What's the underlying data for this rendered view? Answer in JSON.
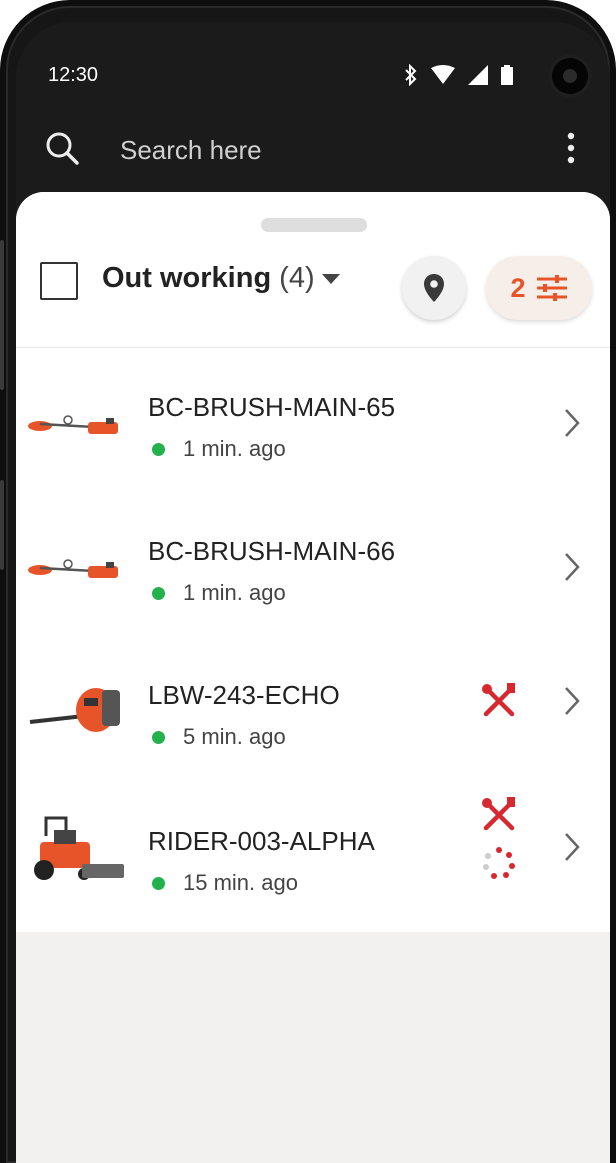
{
  "status_bar": {
    "time": "12:30"
  },
  "search": {
    "placeholder": "Search here"
  },
  "list": {
    "title": "Out working",
    "count": "(4)"
  },
  "filter": {
    "count": "2"
  },
  "items": [
    {
      "name": "BC-BRUSH-MAIN-65",
      "time": "1 min. ago",
      "status_color": "#22b14c",
      "service": false,
      "connectivity": false
    },
    {
      "name": "BC-BRUSH-MAIN-66",
      "time": "1 min. ago",
      "status_color": "#22b14c",
      "service": false,
      "connectivity": false
    },
    {
      "name": "LBW-243-ECHO",
      "time": "5 min. ago",
      "status_color": "#22b14c",
      "service": true,
      "connectivity": false
    },
    {
      "name": "RIDER-003-ALPHA",
      "time": "15 min. ago",
      "status_color": "#22b14c",
      "service": true,
      "connectivity": true
    }
  ],
  "colors": {
    "accent": "#e8542a",
    "warning": "#d7282f",
    "online": "#22b14c"
  },
  "icons": [
    "search-icon",
    "more-vert-icon",
    "bluetooth-icon",
    "wifi-icon",
    "signal-icon",
    "battery-icon",
    "location-pin-icon",
    "filter-sliders-icon",
    "chevron-right-icon",
    "wrench-screwdriver-icon",
    "connectivity-dots-icon"
  ]
}
